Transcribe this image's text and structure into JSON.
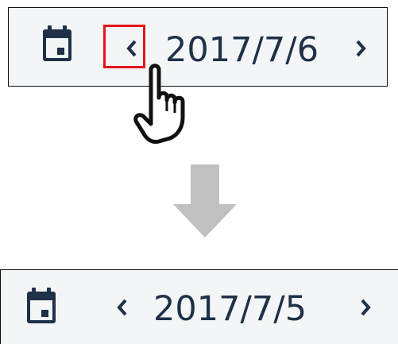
{
  "before": {
    "date_label": "2017/7/6",
    "prev_glyph": "chevron-left",
    "next_glyph": "chevron-right",
    "calendar_icon": "calendar-icon",
    "highlighted_control": "prev-button"
  },
  "after": {
    "date_label": "2017/7/5",
    "prev_glyph": "chevron-left",
    "next_glyph": "chevron-right",
    "calendar_icon": "calendar-icon"
  },
  "annotations": {
    "cursor_icon": "hand-pointer-icon",
    "transition_icon": "arrow-down-icon",
    "highlight_color": "#e3151a"
  },
  "colors": {
    "icon": "#1e3148",
    "bar_background": "#f4f5f7",
    "arrow": "#c0c0c0"
  }
}
